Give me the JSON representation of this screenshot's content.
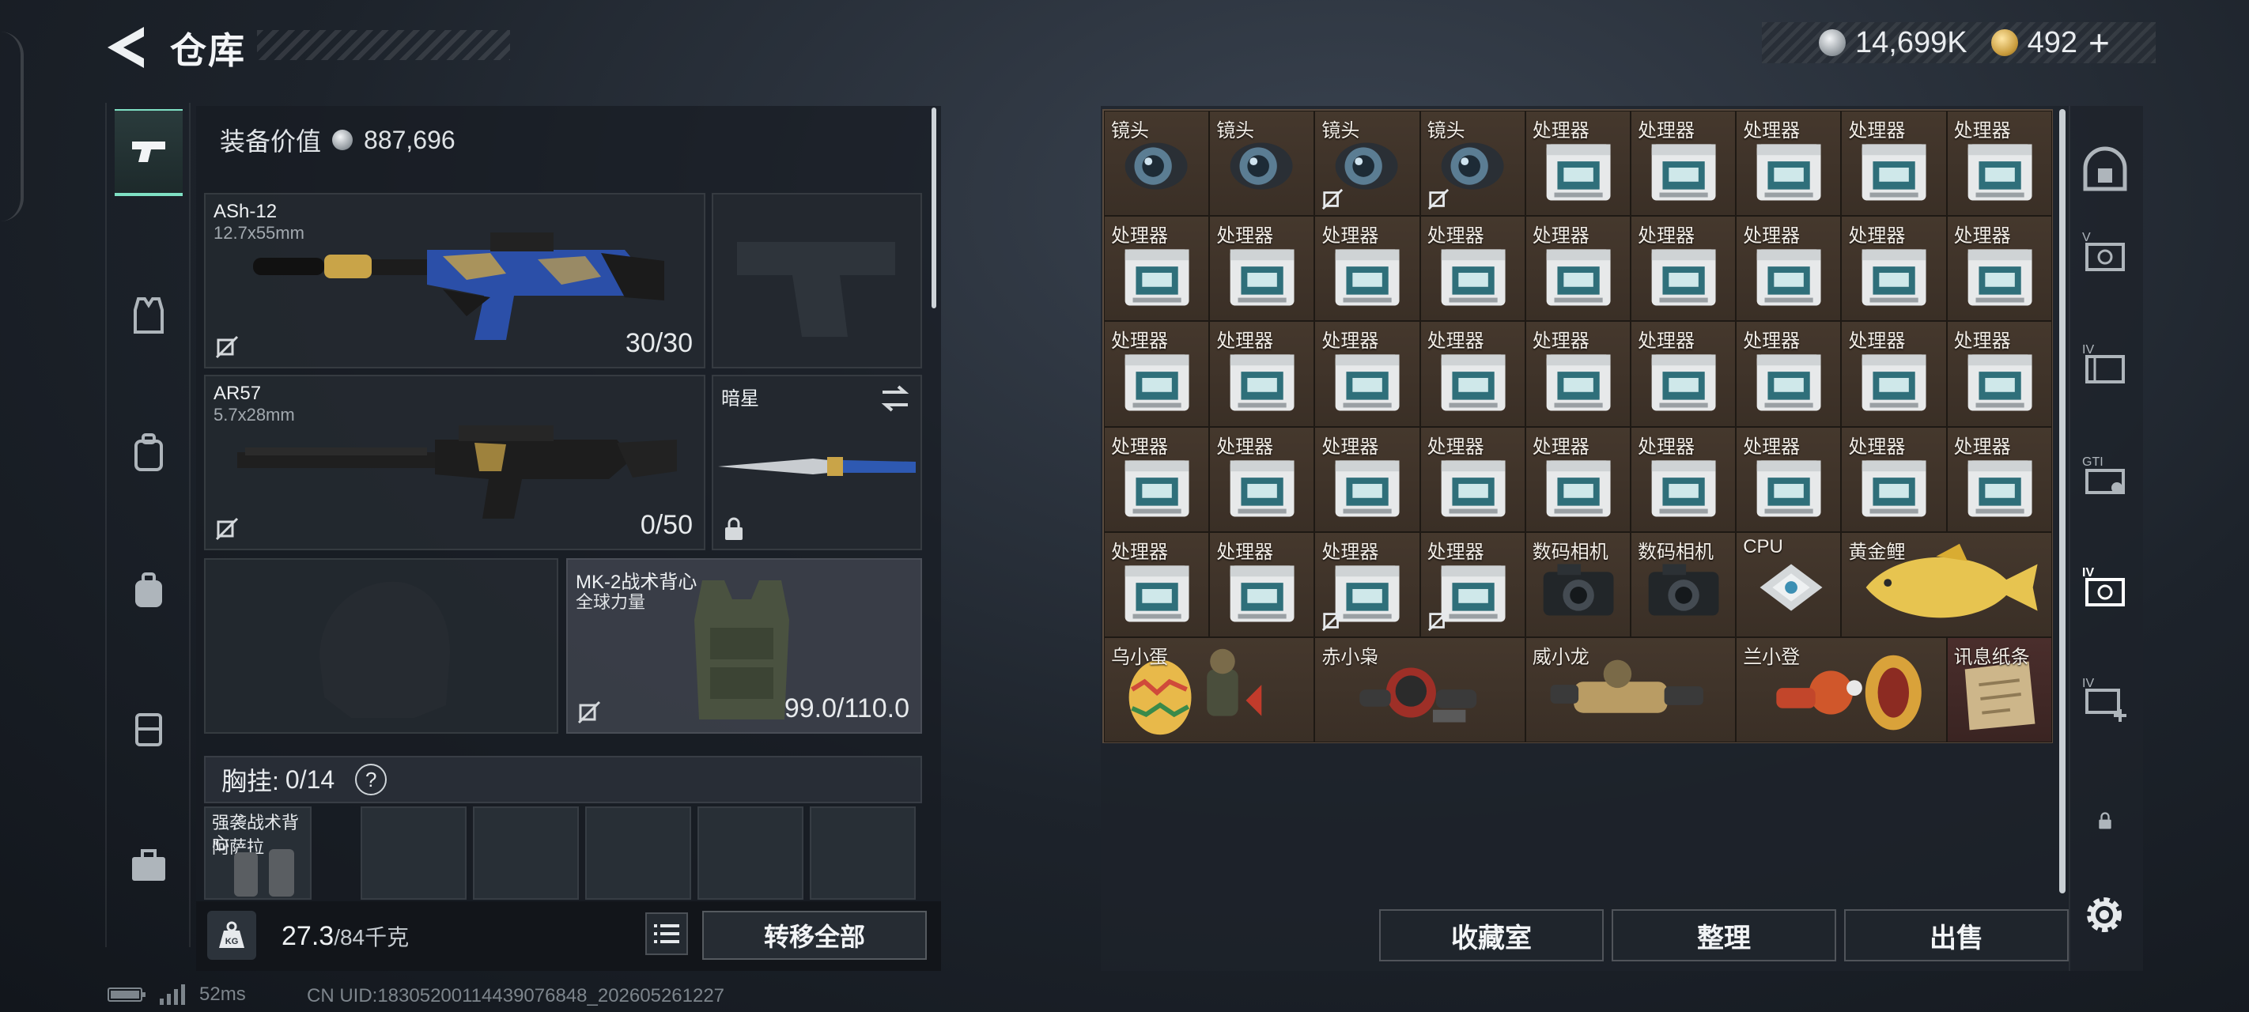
{
  "header": {
    "title": "仓库",
    "silver": "14,699K",
    "gold": "492",
    "plus": "+"
  },
  "equipment": {
    "value_label": "装备价值",
    "value": "887,696",
    "primary": {
      "name": "ASh-12",
      "caliber": "12.7x55mm",
      "ammo": "30/30"
    },
    "secondary": {
      "name": "AR57",
      "caliber": "5.7x28mm",
      "ammo": "0/50"
    },
    "melee": {
      "name": "暗星"
    },
    "armor": {
      "name": "MK-2战术背心",
      "sub": "全球力量",
      "durability": "99.0/110.0"
    },
    "chest": {
      "label": "胸挂:",
      "value": "0/14",
      "help": "?"
    },
    "rig": {
      "name": "强袭战术背心",
      "sub": "阿萨拉"
    }
  },
  "weight": {
    "current": "27.3",
    "max": "/84千克",
    "kg_label": "KG"
  },
  "buttons": {
    "transfer_all": "转移全部",
    "collection": "收藏室",
    "organize": "整理",
    "sell": "出售"
  },
  "status": {
    "ping": "52ms",
    "uid": "CN UID:183052001144390768​48_202605261227"
  },
  "inventory": {
    "lens": "镜头",
    "processor": "处理器",
    "camera": "数码相机",
    "cpu": "CPU",
    "carp": "黄金鲤",
    "specials": [
      "乌小蛋",
      "赤小枭",
      "威小龙",
      "兰小登",
      "讯息纸条"
    ]
  },
  "colors": {
    "accent": "#7fe0c4",
    "grid_bg": "#3a2f27",
    "panel": "#181c22"
  },
  "icons": [
    "back-arrow-icon",
    "pistol-icon",
    "vest-icon",
    "backpack-icon",
    "case-icon",
    "toolbox-icon",
    "silver-coin-icon",
    "gold-coin-icon",
    "kg-icon",
    "list-icon",
    "bound-icon",
    "lock-icon",
    "swap-icon",
    "settings-icon"
  ]
}
